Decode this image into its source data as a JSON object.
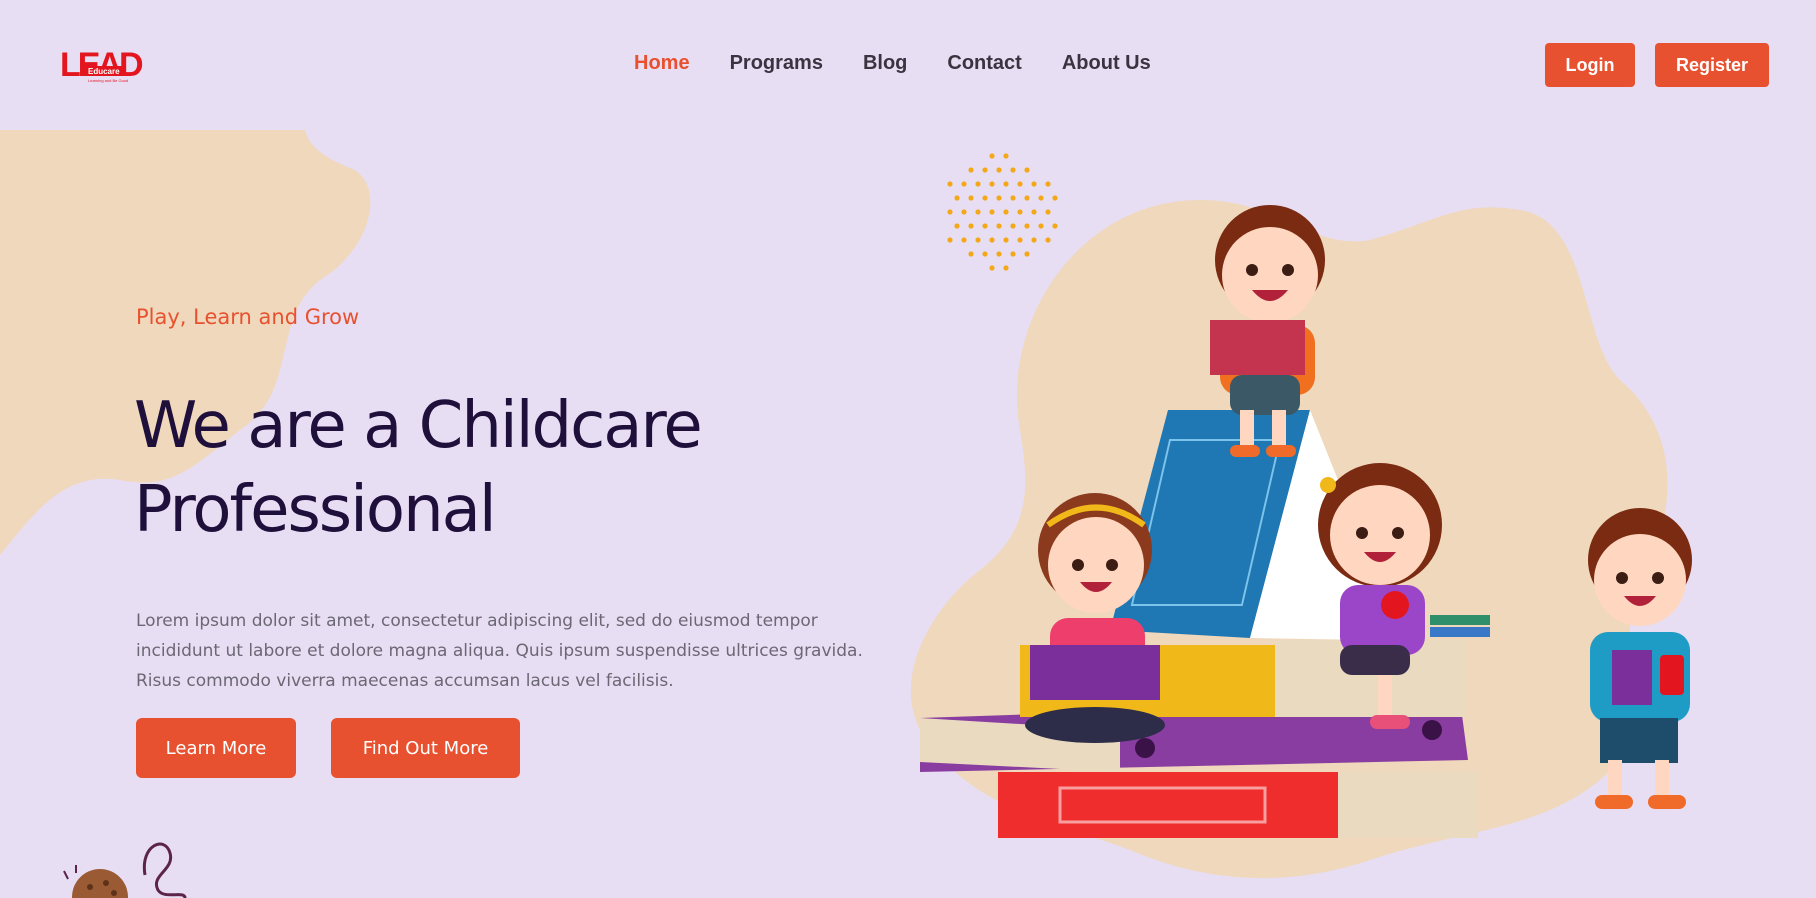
{
  "logo": {
    "text": "LEAD",
    "sub_text": "Educare",
    "tagline": "Learning and Be Good"
  },
  "nav": {
    "items": [
      {
        "label": "Home",
        "active": true
      },
      {
        "label": "Programs",
        "active": false
      },
      {
        "label": "Blog",
        "active": false
      },
      {
        "label": "Contact",
        "active": false
      },
      {
        "label": "About Us",
        "active": false
      }
    ]
  },
  "auth": {
    "login_label": "Login",
    "register_label": "Register"
  },
  "hero": {
    "tagline": "Play, Learn and Grow",
    "headline": "We are a Childcare Professional",
    "description": "Lorem ipsum dolor sit amet, consectetur adipiscing elit, sed do eiusmod tempor incididunt ut labore et dolore magna aliqua. Quis ipsum suspendisse ultrices gravida. Risus commodo viverra maecenas accumsan lacus vel facilisis.",
    "learn_more_label": "Learn More",
    "find_out_more_label": "Find Out More"
  },
  "colors": {
    "background": "#e8def4",
    "accent": "#e8512f",
    "heading": "#1f0f3b",
    "blob": "#efd8bb",
    "dots": "#f2a818"
  },
  "icons": {
    "illustration": "kids-reading-books-illustration",
    "dots": "dot-pattern-decoration",
    "blob": "blob-shape-decoration",
    "bottom": "cookie-scribble-decoration"
  }
}
